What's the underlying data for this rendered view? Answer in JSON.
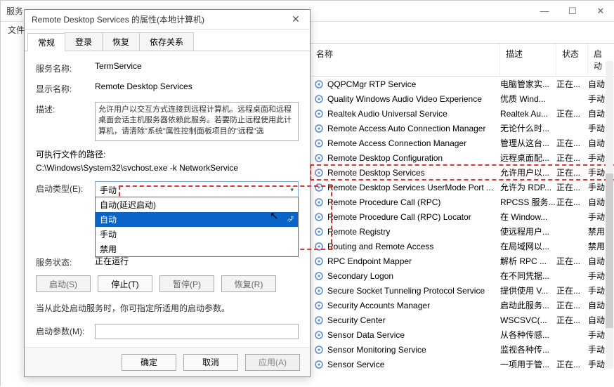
{
  "main_window": {
    "title": "服务",
    "menu_left": "文件",
    "win_min": "—",
    "win_max": "☐",
    "win_close": "✕",
    "columns": {
      "name": "名称",
      "desc": "描述",
      "status": "状态",
      "start": "启动"
    },
    "services": [
      {
        "name": "QQPCMgr RTP Service",
        "desc": "电脑管家实...",
        "status": "正在...",
        "start": "自动"
      },
      {
        "name": "Quality Windows Audio Video Experience",
        "desc": "优质 Wind...",
        "status": "",
        "start": "手动"
      },
      {
        "name": "Realtek Audio Universal Service",
        "desc": "Realtek Au...",
        "status": "正在...",
        "start": "自动"
      },
      {
        "name": "Remote Access Auto Connection Manager",
        "desc": "无论什么时...",
        "status": "",
        "start": "手动"
      },
      {
        "name": "Remote Access Connection Manager",
        "desc": "管理从这台...",
        "status": "正在...",
        "start": "自动"
      },
      {
        "name": "Remote Desktop Configuration",
        "desc": "远程桌面配...",
        "status": "正在...",
        "start": "手动"
      },
      {
        "name": "Remote Desktop Services",
        "desc": "允许用户以...",
        "status": "正在...",
        "start": "手动",
        "hl": true
      },
      {
        "name": "Remote Desktop Services UserMode Port ...",
        "desc": "允许为 RDP...",
        "status": "正在...",
        "start": "手动"
      },
      {
        "name": "Remote Procedure Call (RPC)",
        "desc": "RPCSS 服务...",
        "status": "正在...",
        "start": "自动"
      },
      {
        "name": "Remote Procedure Call (RPC) Locator",
        "desc": "在 Window...",
        "status": "",
        "start": "手动"
      },
      {
        "name": "Remote Registry",
        "desc": "使远程用户...",
        "status": "",
        "start": "禁用"
      },
      {
        "name": "Routing and Remote Access",
        "desc": "在局域网以...",
        "status": "",
        "start": "禁用"
      },
      {
        "name": "RPC Endpoint Mapper",
        "desc": "解析 RPC ...",
        "status": "正在...",
        "start": "自动"
      },
      {
        "name": "Secondary Logon",
        "desc": "在不同凭据...",
        "status": "",
        "start": "手动"
      },
      {
        "name": "Secure Socket Tunneling Protocol Service",
        "desc": "提供使用 V...",
        "status": "正在...",
        "start": "手动"
      },
      {
        "name": "Security Accounts Manager",
        "desc": "启动此服务...",
        "status": "正在...",
        "start": "自动"
      },
      {
        "name": "Security Center",
        "desc": "WSCSVC(...",
        "status": "正在...",
        "start": "自动"
      },
      {
        "name": "Sensor Data Service",
        "desc": "从各种传感...",
        "status": "",
        "start": "手动"
      },
      {
        "name": "Sensor Monitoring Service",
        "desc": "监视各种传...",
        "status": "",
        "start": "手动"
      },
      {
        "name": "Sensor Service",
        "desc": "一项用于管...",
        "status": "正在...",
        "start": "手动"
      }
    ]
  },
  "dialog": {
    "title": "Remote Desktop Services 的属性(本地计算机)",
    "close": "✕",
    "tabs": [
      "常规",
      "登录",
      "恢复",
      "依存关系"
    ],
    "fields": {
      "svc_name_lbl": "服务名称:",
      "svc_name_val": "TermService",
      "disp_name_lbl": "显示名称:",
      "disp_name_val": "Remote Desktop Services",
      "desc_lbl": "描述:",
      "desc_val": "允许用户以交互方式连接到远程计算机。远程桌面和远程桌面会话主机服务器依赖此服务。若要防止远程使用此计算机，请清除\"系统\"属性控制面板项目的\"远程\"选",
      "path_lbl": "可执行文件的路径:",
      "path_val": "C:\\Windows\\System32\\svchost.exe -k NetworkService",
      "start_type_lbl": "启动类型(E):",
      "start_type_val": "手动",
      "dropdown": [
        "自动(延迟启动)",
        "自动",
        "手动",
        "禁用"
      ],
      "svc_status_lbl": "服务状态:",
      "svc_status_val": "正在运行",
      "btn_start": "启动(S)",
      "btn_stop": "停止(T)",
      "btn_pause": "暂停(P)",
      "btn_resume": "恢复(R)",
      "hint": "当从此处启动服务时，你可指定所适用的启动参数。",
      "param_lbl": "启动参数(M):"
    },
    "footer": {
      "ok": "确定",
      "cancel": "取消",
      "apply": "应用(A)"
    }
  }
}
